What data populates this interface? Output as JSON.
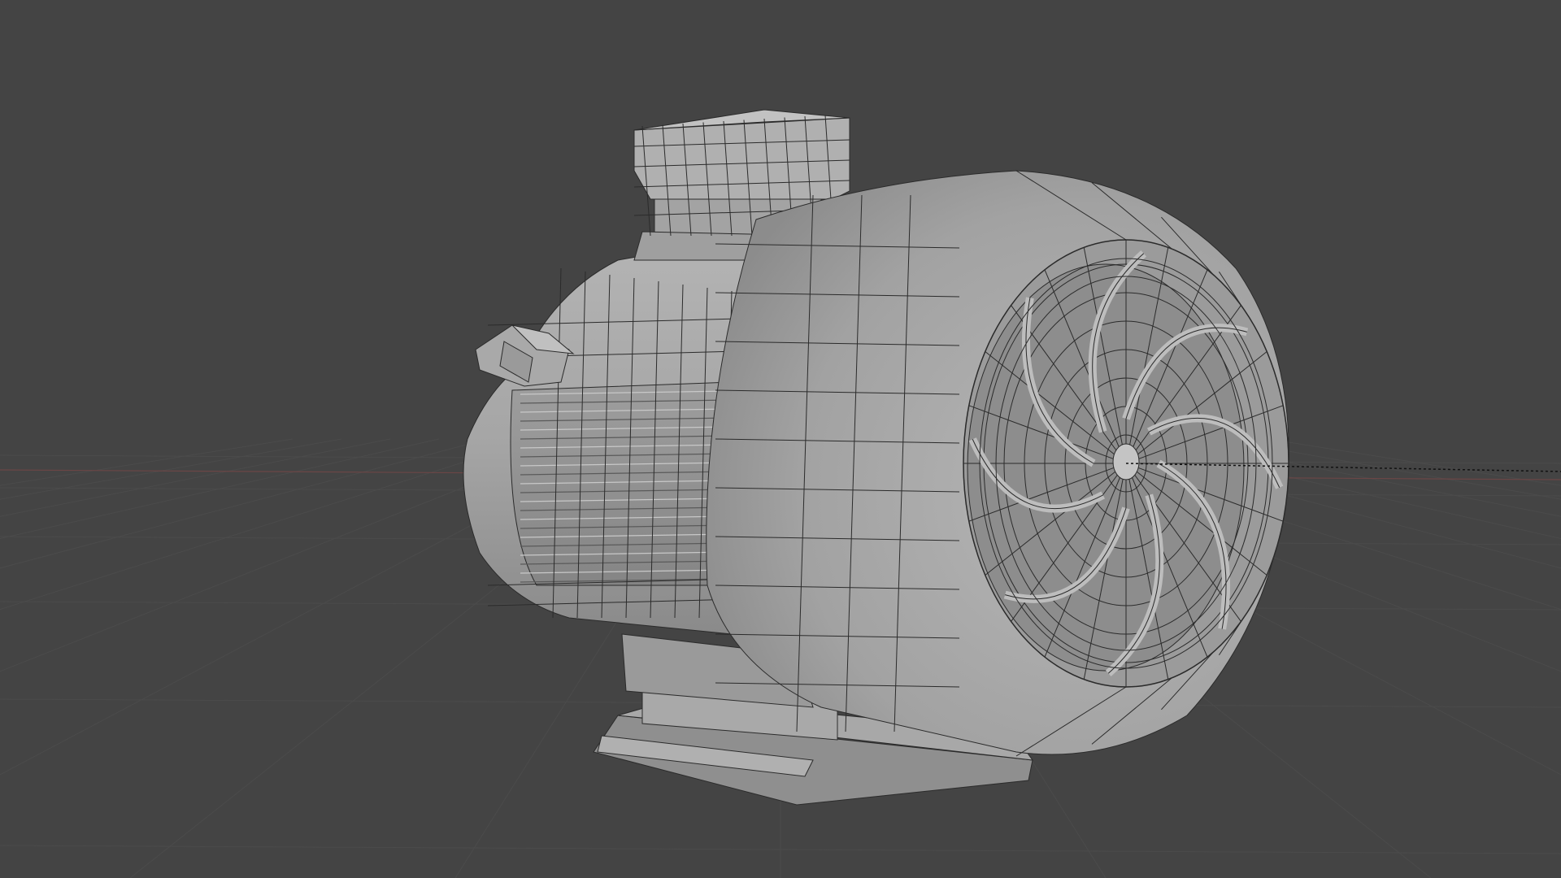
{
  "viewport": {
    "background_color": "#444444",
    "grid_line_color": "#4d4d4d",
    "x_axis_color": "#7a4a4a",
    "y_axis_dash_color": "#000000"
  },
  "model": {
    "name": "electric-motor",
    "shading": "solid",
    "wireframe_overlay": true,
    "base_color": "#a4a4a4",
    "light_color": "#bdbdbd",
    "dark_color": "#7c7c7c",
    "edge_color": "#2b2b2b",
    "parts": {
      "terminal_box": "terminal-box",
      "side_connector": "side-connector",
      "housing": "finned-housing",
      "fan_cover": "fan-cover",
      "fan_grille": "fan-grille",
      "mounting_foot": "mounting-foot"
    }
  }
}
